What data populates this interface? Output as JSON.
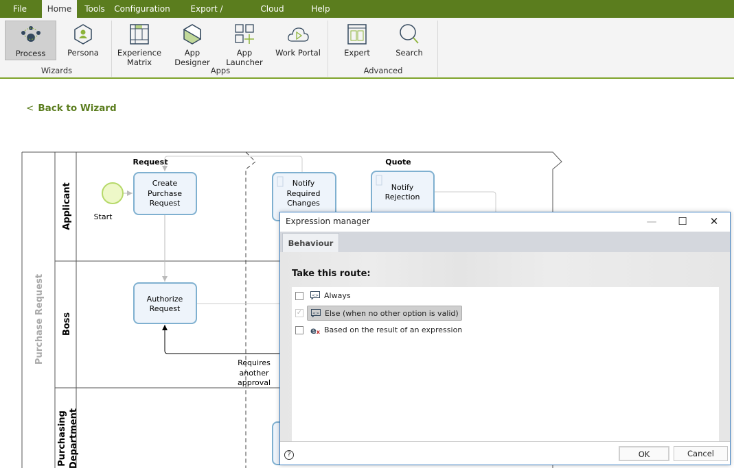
{
  "menu": {
    "items": [
      "File",
      "Home",
      "Tools",
      "Configuration",
      "Export / Import",
      "Cloud Services",
      "Help"
    ],
    "active": "Home"
  },
  "ribbon": {
    "groups": [
      "Wizards",
      "Apps",
      "Advanced"
    ],
    "buttons": {
      "process": "Process",
      "persona": "Persona",
      "experience_matrix_1": "Experience",
      "experience_matrix_2": "Matrix",
      "app_designer": "App Designer",
      "app_launcher": "App Launcher",
      "work_portal": "Work Portal",
      "expert": "Expert",
      "search": "Search"
    }
  },
  "back_link": "Back to Wizard",
  "diagram": {
    "pool": "Purchase Request",
    "lanes": [
      "Applicant",
      "Boss",
      "Purchasing",
      "Department"
    ],
    "phases": [
      "Request",
      "Quote"
    ],
    "start_label": "Start",
    "tasks": {
      "create": [
        "Create",
        "Purchase",
        "Request"
      ],
      "authorize": [
        "Authorize",
        "Request"
      ],
      "notify_changes": [
        "Notify",
        "Required",
        "Changes"
      ],
      "notify_rejection": [
        "Notify",
        "Rejection"
      ]
    },
    "flow_label": [
      "Requires",
      "another",
      "approval"
    ]
  },
  "dialog": {
    "title": "Expression manager",
    "tab": "Behaviour",
    "heading": "Take this route:",
    "options": [
      {
        "label": "Always",
        "checked": false
      },
      {
        "label": "Else (when no other option is valid)",
        "checked": true
      },
      {
        "label": "Based on the result of an expression",
        "checked": false
      }
    ],
    "ok": "OK",
    "cancel": "Cancel",
    "help": "?"
  },
  "colors": {
    "brand": "#5b7d1e",
    "accent_line": "#7ea32b",
    "task_border": "#7fb0d0",
    "task_fill": "#eef4fb",
    "start_fill": "#eef8c8"
  }
}
